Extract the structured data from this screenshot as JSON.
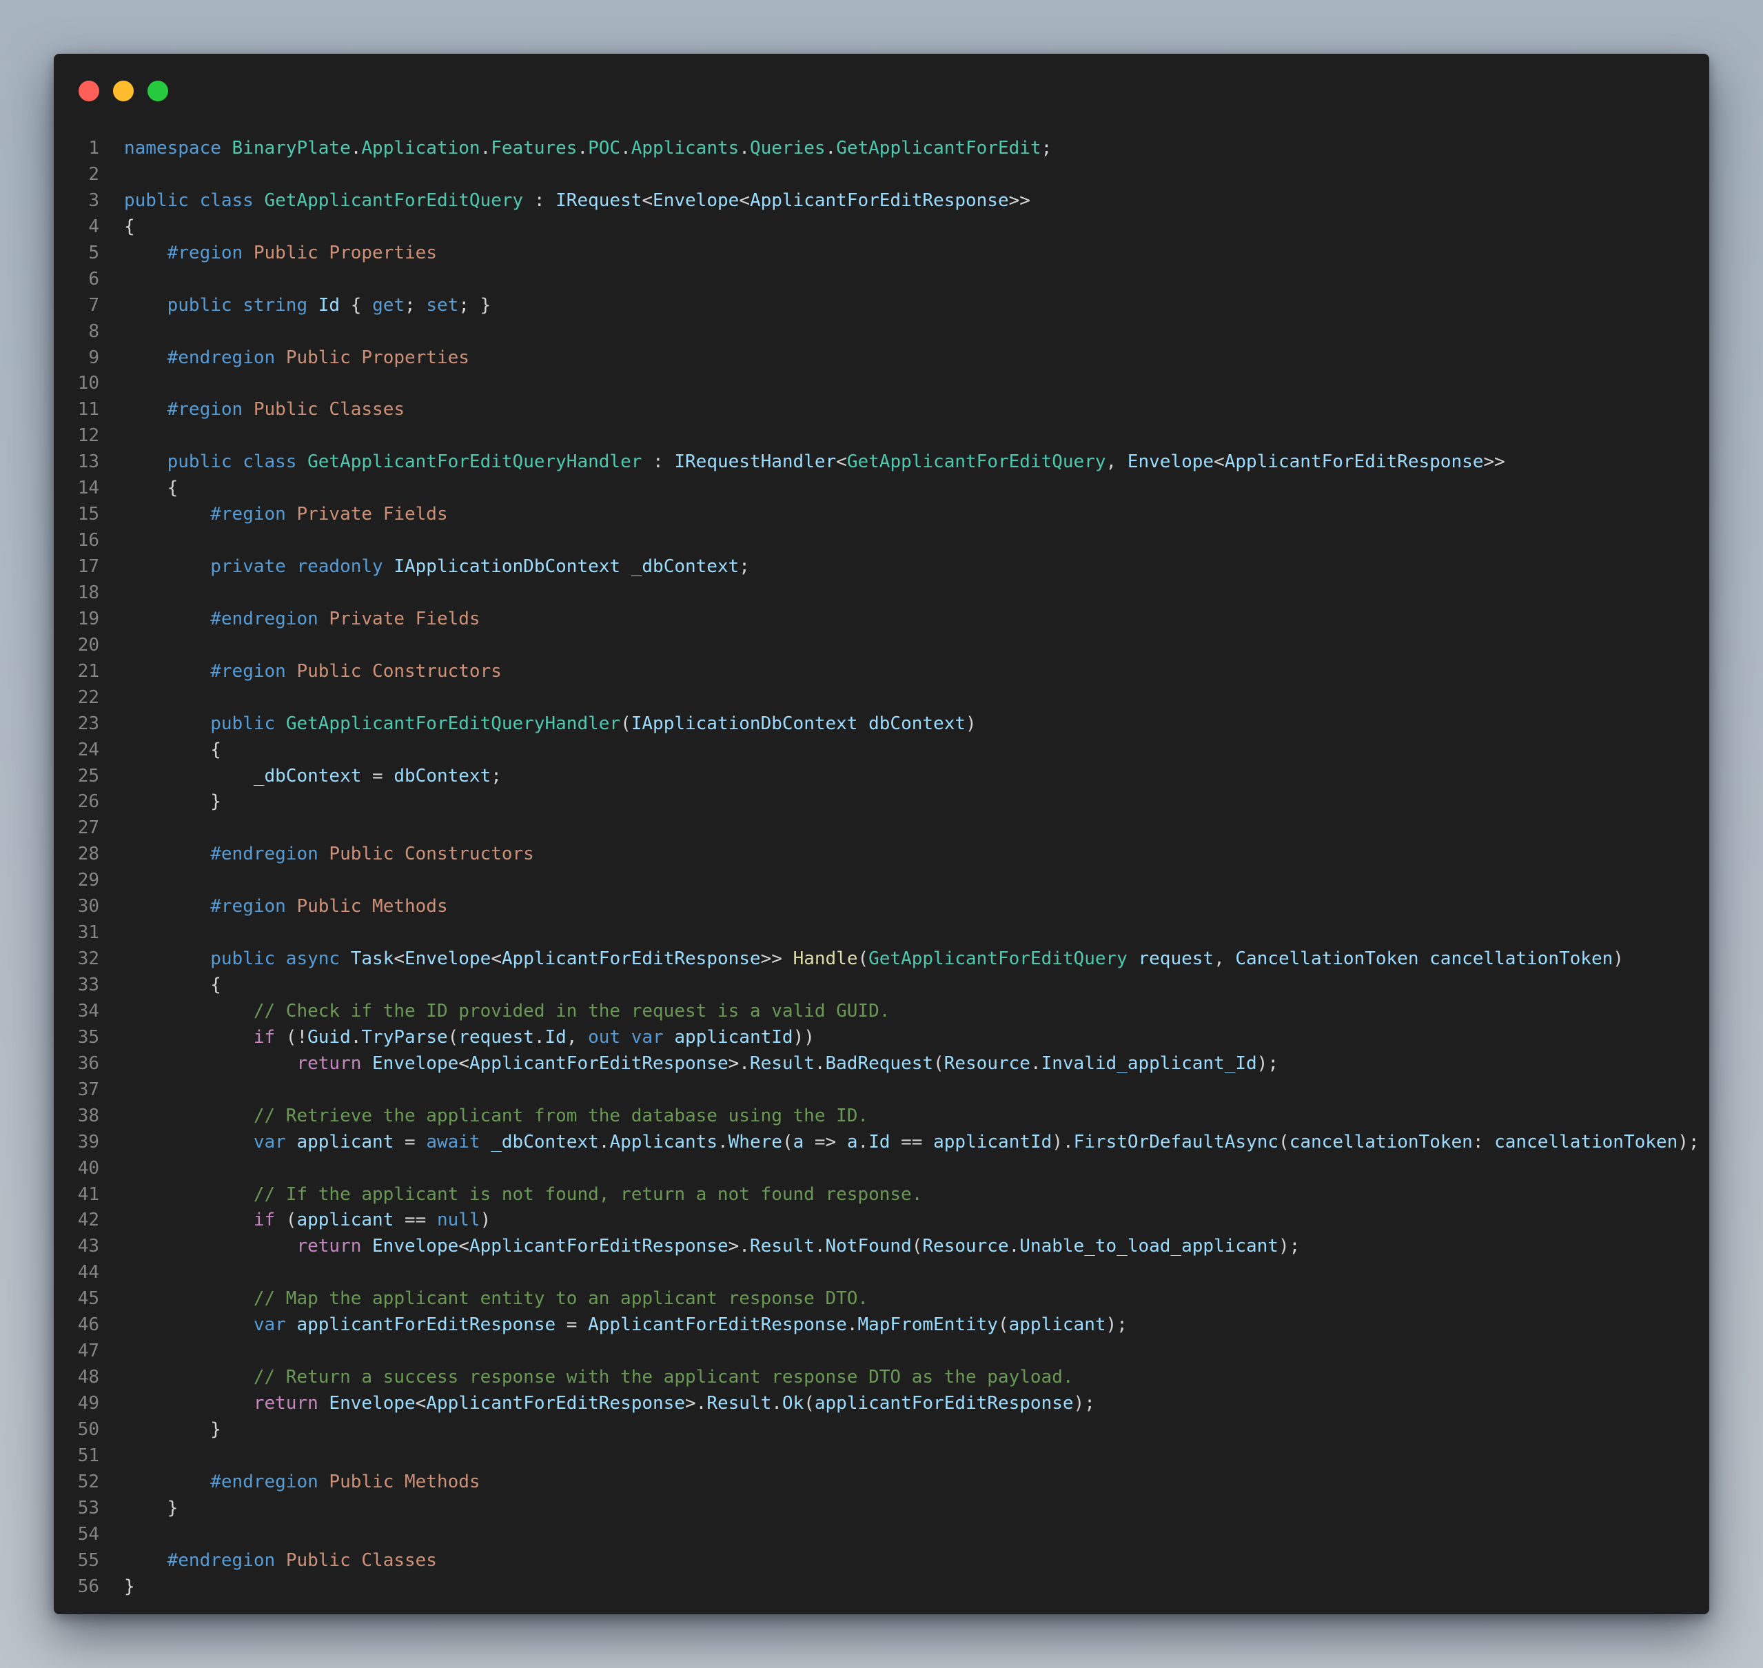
{
  "window": {
    "controls": [
      {
        "name": "close",
        "color": "#ff5f56"
      },
      {
        "name": "minimize",
        "color": "#ffbd2e"
      },
      {
        "name": "maximize",
        "color": "#27c93f"
      }
    ]
  },
  "theme": {
    "keyword": "#569cd6",
    "control": "#c586c0",
    "type": "#4ec9b0",
    "external": "#9cdcfe",
    "function": "#dcdcaa",
    "comment": "#6a9955",
    "region": "#ce9178",
    "punct": "#d4d4d4",
    "line_number": "#858585",
    "background": "#1e1e1e"
  },
  "code": {
    "lines": [
      [
        [
          "kw",
          "namespace "
        ],
        [
          "ty",
          "BinaryPlate"
        ],
        [
          "pn",
          "."
        ],
        [
          "ty",
          "Application"
        ],
        [
          "pn",
          "."
        ],
        [
          "ty",
          "Features"
        ],
        [
          "pn",
          "."
        ],
        [
          "ty",
          "POC"
        ],
        [
          "pn",
          "."
        ],
        [
          "ty",
          "Applicants"
        ],
        [
          "pn",
          "."
        ],
        [
          "ty",
          "Queries"
        ],
        [
          "pn",
          "."
        ],
        [
          "ty",
          "GetApplicantForEdit"
        ],
        [
          "pn",
          ";"
        ]
      ],
      [],
      [
        [
          "kw",
          "public class "
        ],
        [
          "ty",
          "GetApplicantForEditQuery"
        ],
        [
          "pn",
          " : "
        ],
        [
          "ex",
          "IRequest"
        ],
        [
          "pn",
          "<"
        ],
        [
          "ex",
          "Envelope"
        ],
        [
          "pn",
          "<"
        ],
        [
          "ex",
          "ApplicantForEditResponse"
        ],
        [
          "pn",
          ">>"
        ]
      ],
      [
        [
          "pn",
          "{"
        ]
      ],
      [
        [
          "pn",
          "    "
        ],
        [
          "kw",
          "#region "
        ],
        [
          "rg",
          "Public Properties"
        ]
      ],
      [],
      [
        [
          "pn",
          "    "
        ],
        [
          "kw",
          "public string "
        ],
        [
          "ex",
          "Id"
        ],
        [
          "pn",
          " { "
        ],
        [
          "kw",
          "get"
        ],
        [
          "pn",
          "; "
        ],
        [
          "kw",
          "set"
        ],
        [
          "pn",
          "; }"
        ]
      ],
      [],
      [
        [
          "pn",
          "    "
        ],
        [
          "kw",
          "#endregion "
        ],
        [
          "rg",
          "Public Properties"
        ]
      ],
      [],
      [
        [
          "pn",
          "    "
        ],
        [
          "kw",
          "#region "
        ],
        [
          "rg",
          "Public Classes"
        ]
      ],
      [],
      [
        [
          "pn",
          "    "
        ],
        [
          "kw",
          "public class "
        ],
        [
          "ty",
          "GetApplicantForEditQueryHandler"
        ],
        [
          "pn",
          " : "
        ],
        [
          "ex",
          "IRequestHandler"
        ],
        [
          "pn",
          "<"
        ],
        [
          "ty",
          "GetApplicantForEditQuery"
        ],
        [
          "pn",
          ", "
        ],
        [
          "ex",
          "Envelope"
        ],
        [
          "pn",
          "<"
        ],
        [
          "ex",
          "ApplicantForEditResponse"
        ],
        [
          "pn",
          ">>"
        ]
      ],
      [
        [
          "pn",
          "    {"
        ]
      ],
      [
        [
          "pn",
          "        "
        ],
        [
          "kw",
          "#region "
        ],
        [
          "rg",
          "Private Fields"
        ]
      ],
      [],
      [
        [
          "pn",
          "        "
        ],
        [
          "kw",
          "private readonly "
        ],
        [
          "ex",
          "IApplicationDbContext"
        ],
        [
          "pn",
          " "
        ],
        [
          "ex",
          "_dbContext"
        ],
        [
          "pn",
          ";"
        ]
      ],
      [],
      [
        [
          "pn",
          "        "
        ],
        [
          "kw",
          "#endregion "
        ],
        [
          "rg",
          "Private Fields"
        ]
      ],
      [],
      [
        [
          "pn",
          "        "
        ],
        [
          "kw",
          "#region "
        ],
        [
          "rg",
          "Public Constructors"
        ]
      ],
      [],
      [
        [
          "pn",
          "        "
        ],
        [
          "kw",
          "public "
        ],
        [
          "ty",
          "GetApplicantForEditQueryHandler"
        ],
        [
          "pn",
          "("
        ],
        [
          "ex",
          "IApplicationDbContext"
        ],
        [
          "pn",
          " "
        ],
        [
          "ex",
          "dbContext"
        ],
        [
          "pn",
          ")"
        ]
      ],
      [
        [
          "pn",
          "        {"
        ]
      ],
      [
        [
          "pn",
          "            "
        ],
        [
          "ex",
          "_dbContext"
        ],
        [
          "pn",
          " = "
        ],
        [
          "ex",
          "dbContext"
        ],
        [
          "pn",
          ";"
        ]
      ],
      [
        [
          "pn",
          "        }"
        ]
      ],
      [],
      [
        [
          "pn",
          "        "
        ],
        [
          "kw",
          "#endregion "
        ],
        [
          "rg",
          "Public Constructors"
        ]
      ],
      [],
      [
        [
          "pn",
          "        "
        ],
        [
          "kw",
          "#region "
        ],
        [
          "rg",
          "Public Methods"
        ]
      ],
      [],
      [
        [
          "pn",
          "        "
        ],
        [
          "kw",
          "public async "
        ],
        [
          "ex",
          "Task"
        ],
        [
          "pn",
          "<"
        ],
        [
          "ex",
          "Envelope"
        ],
        [
          "pn",
          "<"
        ],
        [
          "ex",
          "ApplicantForEditResponse"
        ],
        [
          "pn",
          ">> "
        ],
        [
          "fn",
          "Handle"
        ],
        [
          "pn",
          "("
        ],
        [
          "ty",
          "GetApplicantForEditQuery"
        ],
        [
          "pn",
          " "
        ],
        [
          "ex",
          "request"
        ],
        [
          "pn",
          ", "
        ],
        [
          "ex",
          "CancellationToken"
        ],
        [
          "pn",
          " "
        ],
        [
          "ex",
          "cancellationToken"
        ],
        [
          "pn",
          ")"
        ]
      ],
      [
        [
          "pn",
          "        {"
        ]
      ],
      [
        [
          "pn",
          "            "
        ],
        [
          "cm",
          "// Check if the ID provided in the request is a valid GUID."
        ]
      ],
      [
        [
          "pn",
          "            "
        ],
        [
          "ctl",
          "if"
        ],
        [
          "pn",
          " (!"
        ],
        [
          "ex",
          "Guid"
        ],
        [
          "pn",
          "."
        ],
        [
          "ex",
          "TryParse"
        ],
        [
          "pn",
          "("
        ],
        [
          "ex",
          "request"
        ],
        [
          "pn",
          "."
        ],
        [
          "ex",
          "Id"
        ],
        [
          "pn",
          ", "
        ],
        [
          "kw",
          "out var "
        ],
        [
          "ex",
          "applicantId"
        ],
        [
          "pn",
          "))"
        ]
      ],
      [
        [
          "pn",
          "                "
        ],
        [
          "ctl",
          "return "
        ],
        [
          "ex",
          "Envelope"
        ],
        [
          "pn",
          "<"
        ],
        [
          "ex",
          "ApplicantForEditResponse"
        ],
        [
          "pn",
          ">."
        ],
        [
          "ex",
          "Result"
        ],
        [
          "pn",
          "."
        ],
        [
          "ex",
          "BadRequest"
        ],
        [
          "pn",
          "("
        ],
        [
          "ex",
          "Resource"
        ],
        [
          "pn",
          "."
        ],
        [
          "ex",
          "Invalid_applicant_Id"
        ],
        [
          "pn",
          ");"
        ]
      ],
      [],
      [
        [
          "pn",
          "            "
        ],
        [
          "cm",
          "// Retrieve the applicant from the database using the ID."
        ]
      ],
      [
        [
          "pn",
          "            "
        ],
        [
          "kw",
          "var "
        ],
        [
          "ex",
          "applicant"
        ],
        [
          "pn",
          " = "
        ],
        [
          "kw",
          "await "
        ],
        [
          "ex",
          "_dbContext"
        ],
        [
          "pn",
          "."
        ],
        [
          "ex",
          "Applicants"
        ],
        [
          "pn",
          "."
        ],
        [
          "ex",
          "Where"
        ],
        [
          "pn",
          "("
        ],
        [
          "ex",
          "a"
        ],
        [
          "pn",
          " => "
        ],
        [
          "ex",
          "a"
        ],
        [
          "pn",
          "."
        ],
        [
          "ex",
          "Id"
        ],
        [
          "pn",
          " == "
        ],
        [
          "ex",
          "applicantId"
        ],
        [
          "pn",
          ")."
        ],
        [
          "ex",
          "FirstOrDefaultAsync"
        ],
        [
          "pn",
          "("
        ],
        [
          "ex",
          "cancellationToken"
        ],
        [
          "pn",
          ": "
        ],
        [
          "ex",
          "cancellationToken"
        ],
        [
          "pn",
          ");"
        ]
      ],
      [],
      [
        [
          "pn",
          "            "
        ],
        [
          "cm",
          "// If the applicant is not found, return a not found response."
        ]
      ],
      [
        [
          "pn",
          "            "
        ],
        [
          "ctl",
          "if"
        ],
        [
          "pn",
          " ("
        ],
        [
          "ex",
          "applicant"
        ],
        [
          "pn",
          " == "
        ],
        [
          "kw",
          "null"
        ],
        [
          "pn",
          ")"
        ]
      ],
      [
        [
          "pn",
          "                "
        ],
        [
          "ctl",
          "return "
        ],
        [
          "ex",
          "Envelope"
        ],
        [
          "pn",
          "<"
        ],
        [
          "ex",
          "ApplicantForEditResponse"
        ],
        [
          "pn",
          ">."
        ],
        [
          "ex",
          "Result"
        ],
        [
          "pn",
          "."
        ],
        [
          "ex",
          "NotFound"
        ],
        [
          "pn",
          "("
        ],
        [
          "ex",
          "Resource"
        ],
        [
          "pn",
          "."
        ],
        [
          "ex",
          "Unable_to_load_applicant"
        ],
        [
          "pn",
          ");"
        ]
      ],
      [],
      [
        [
          "pn",
          "            "
        ],
        [
          "cm",
          "// Map the applicant entity to an applicant response DTO."
        ]
      ],
      [
        [
          "pn",
          "            "
        ],
        [
          "kw",
          "var "
        ],
        [
          "ex",
          "applicantForEditResponse"
        ],
        [
          "pn",
          " = "
        ],
        [
          "ex",
          "ApplicantForEditResponse"
        ],
        [
          "pn",
          "."
        ],
        [
          "ex",
          "MapFromEntity"
        ],
        [
          "pn",
          "("
        ],
        [
          "ex",
          "applicant"
        ],
        [
          "pn",
          ");"
        ]
      ],
      [],
      [
        [
          "pn",
          "            "
        ],
        [
          "cm",
          "// Return a success response with the applicant response DTO as the payload."
        ]
      ],
      [
        [
          "pn",
          "            "
        ],
        [
          "ctl",
          "return "
        ],
        [
          "ex",
          "Envelope"
        ],
        [
          "pn",
          "<"
        ],
        [
          "ex",
          "ApplicantForEditResponse"
        ],
        [
          "pn",
          ">."
        ],
        [
          "ex",
          "Result"
        ],
        [
          "pn",
          "."
        ],
        [
          "ex",
          "Ok"
        ],
        [
          "pn",
          "("
        ],
        [
          "ex",
          "applicantForEditResponse"
        ],
        [
          "pn",
          ");"
        ]
      ],
      [
        [
          "pn",
          "        }"
        ]
      ],
      [],
      [
        [
          "pn",
          "        "
        ],
        [
          "kw",
          "#endregion "
        ],
        [
          "rg",
          "Public Methods"
        ]
      ],
      [
        [
          "pn",
          "    }"
        ]
      ],
      [],
      [
        [
          "pn",
          "    "
        ],
        [
          "kw",
          "#endregion "
        ],
        [
          "rg",
          "Public Classes"
        ]
      ],
      [
        [
          "pn",
          "}"
        ]
      ]
    ]
  }
}
